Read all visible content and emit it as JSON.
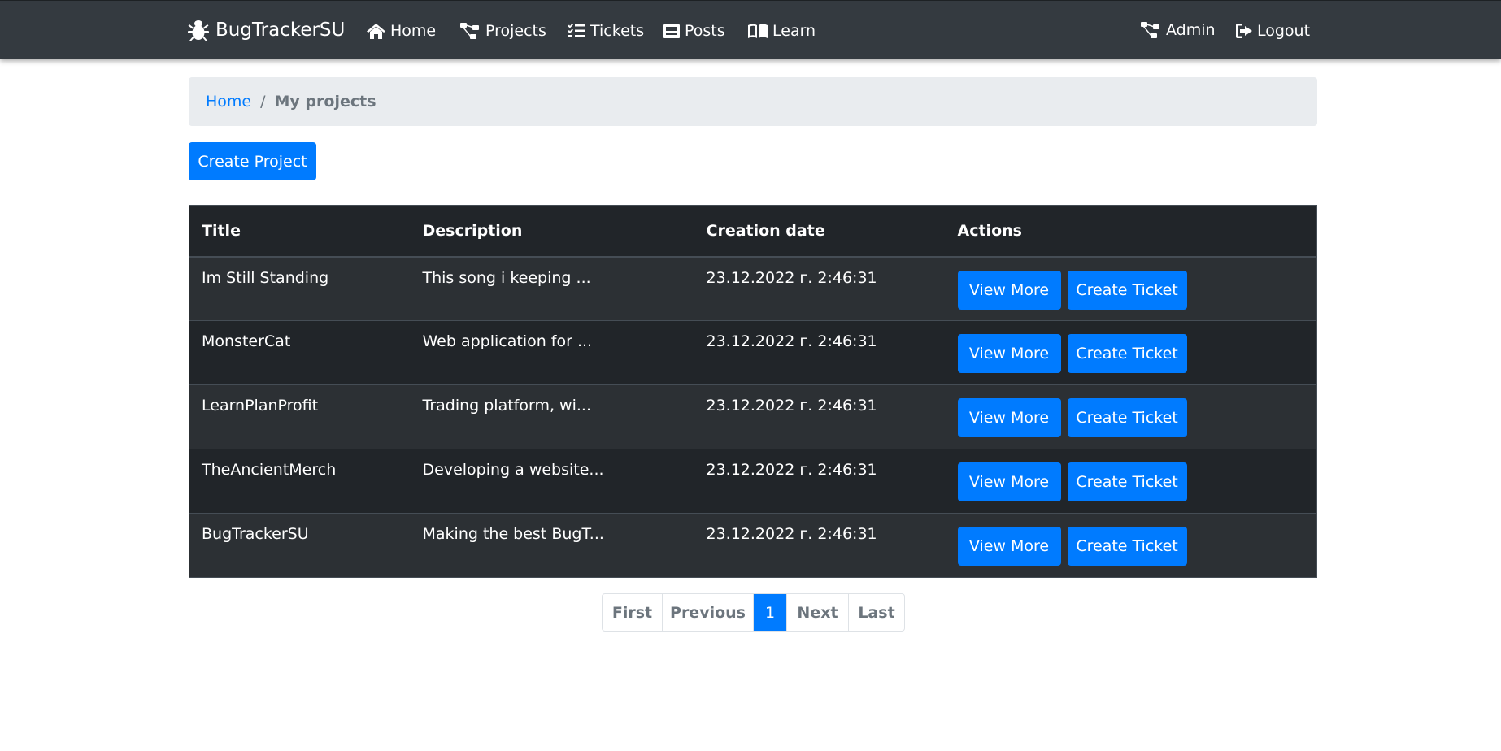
{
  "navbar": {
    "brand": "BugTrackerSU",
    "links": [
      {
        "label": "Home",
        "icon": "home-icon"
      },
      {
        "label": "Projects",
        "icon": "sitemap-icon"
      },
      {
        "label": "Tickets",
        "icon": "tasks-icon"
      },
      {
        "label": "Posts",
        "icon": "newspaper-icon"
      },
      {
        "label": "Learn",
        "icon": "book-icon"
      }
    ],
    "right_links": [
      {
        "label": "Admin",
        "icon": "sitemap-icon"
      },
      {
        "label": "Logout",
        "icon": "sign-out-icon"
      }
    ]
  },
  "breadcrumb": {
    "home": "Home",
    "separator": "/",
    "current": "My projects"
  },
  "create_project_label": "Create Project",
  "table": {
    "headers": [
      "Title",
      "Description",
      "Creation date",
      "Actions"
    ],
    "rows": [
      {
        "title": "Im Still Standing",
        "description": "This song i keeping ...",
        "date": "23.12.2022 г. 2:46:31"
      },
      {
        "title": "MonsterCat",
        "description": "Web application for ...",
        "date": "23.12.2022 г. 2:46:31"
      },
      {
        "title": "LearnPlanProfit",
        "description": "Trading platform, wi...",
        "date": "23.12.2022 г. 2:46:31"
      },
      {
        "title": "TheAncientMerch",
        "description": "Developing a website...",
        "date": "23.12.2022 г. 2:46:31"
      },
      {
        "title": "BugTrackerSU",
        "description": "Making the best BugT...",
        "date": "23.12.2022 г. 2:46:31"
      }
    ],
    "view_more_label": "View More",
    "create_ticket_label": "Create Ticket"
  },
  "pagination": {
    "first": "First",
    "previous": "Previous",
    "current_page": "1",
    "next": "Next",
    "last": "Last"
  },
  "colors": {
    "navbar": "#343a40",
    "primary": "#007bff",
    "table_dark": "#212529",
    "table_stripe": "#2c3034",
    "breadcrumb_bg": "#e9ecef"
  }
}
